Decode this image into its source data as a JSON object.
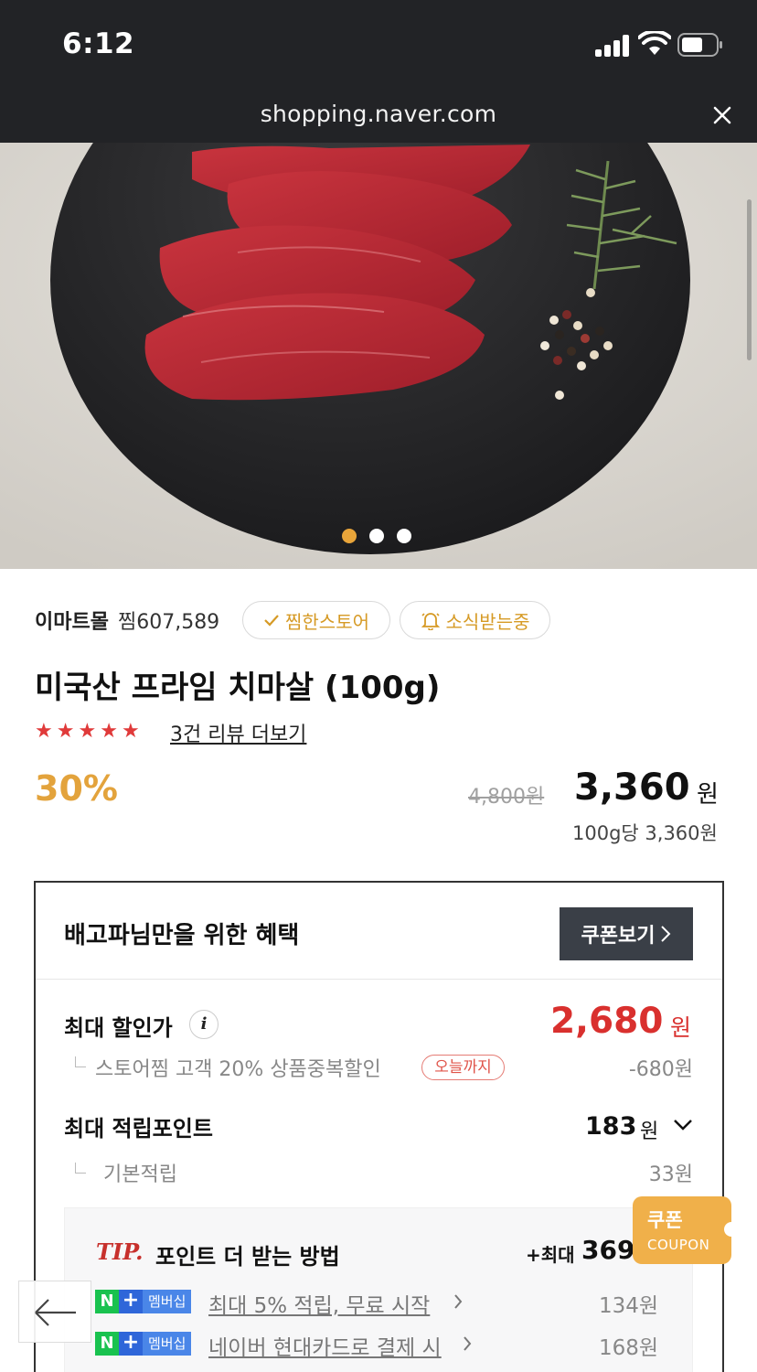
{
  "status_bar": {
    "time": "6:12"
  },
  "browser": {
    "url": "shopping.naver.com"
  },
  "gallery": {
    "total_slides": 3,
    "active_slide": 1
  },
  "store": {
    "name": "이마트몰",
    "likes": "찜607,589",
    "liked_label": "찜한스토어",
    "notify_label": "소식받는중"
  },
  "product": {
    "title": "미국산 프라임 치마살 (100g)",
    "rating_stars": 5,
    "review_link": "3건 리뷰 더보기",
    "discount_rate": "30%",
    "original_price": "4,800원",
    "price": "3,360",
    "price_unit": "원",
    "unit_price": "100g당 3,360원"
  },
  "benefit": {
    "title": "배고파님만을 위한 혜택",
    "coupon_button": "쿠폰보기",
    "max_discount_label": "최대 할인가",
    "max_discount_price": "2,680",
    "max_discount_unit": "원",
    "store_discount_text": "스토어찜 고객 20% 상품중복할인",
    "today_badge": "오늘까지",
    "store_discount_amount": "-680원",
    "points_label": "최대 적립포인트",
    "points_value": "183",
    "points_unit": "원",
    "base_points_label": "기본적립",
    "base_points_value": "33원"
  },
  "tip": {
    "tag": "TIP.",
    "title": "포인트 더 받는 방법",
    "max_prefix": "+최대",
    "max_value": "369",
    "items": [
      {
        "badge_n": "N",
        "badge_plus": "+",
        "badge_text": "멤버십",
        "text": "최대 5% 적립, 무료 시작",
        "amount": "134원"
      },
      {
        "badge_n": "N",
        "badge_plus": "+",
        "badge_text": "멤버십",
        "text": "네이버 현대카드로 결제 시",
        "amount": "168원"
      }
    ]
  },
  "floating_coupon": {
    "label_ko": "쿠폰",
    "label_en": "COUPON"
  },
  "colors": {
    "topbar": "#222326",
    "accent": "#e3a33c",
    "sale_red": "#d9302e",
    "star_red": "#e03a3a",
    "membership_green": "#19c24f",
    "membership_blue": "#2f66d9"
  },
  "icons": {
    "close": "close-icon",
    "check": "check-icon",
    "bell": "bell-icon",
    "chevron_right": "chevron-right-icon",
    "chevron_down": "chevron-down-icon",
    "info": "info-icon",
    "back": "arrow-left-icon"
  }
}
